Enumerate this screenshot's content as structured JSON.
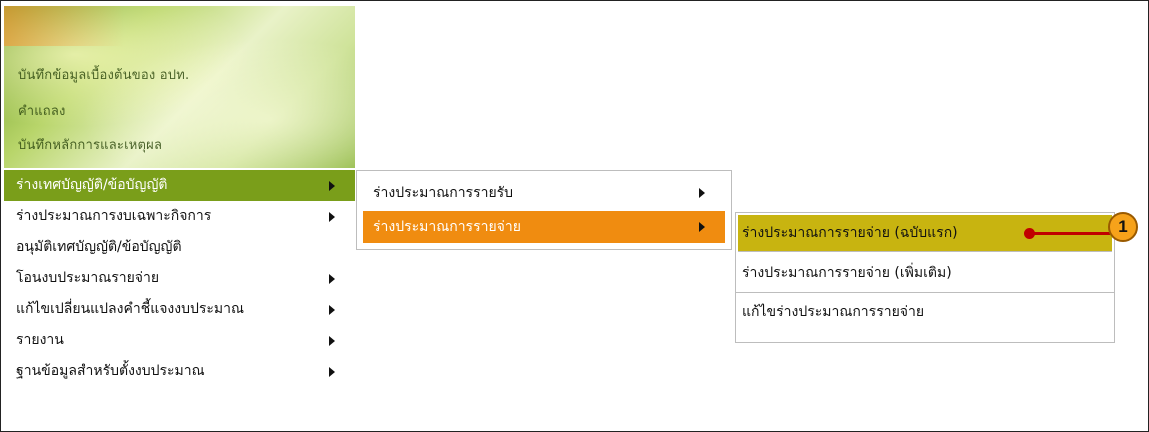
{
  "banner": {
    "items": [
      "บันทึกข้อมูลเบื้องต้นของ อปท.",
      "คำแถลง",
      "บันทึกหลักการและเหตุผล"
    ]
  },
  "menu_level1": {
    "items": [
      {
        "label": "ร่างเทศบัญญัติ/ข้อบัญญัติ",
        "has_submenu": true,
        "active": true
      },
      {
        "label": "ร่างประมาณการงบเฉพาะกิจการ",
        "has_submenu": true,
        "active": false
      },
      {
        "label": "อนุมัติเทศบัญญัติ/ข้อบัญญัติ",
        "has_submenu": false,
        "active": false
      },
      {
        "label": "โอนงบประมาณรายจ่าย",
        "has_submenu": true,
        "active": false
      },
      {
        "label": "แก้ไขเปลี่ยนแปลงคำชี้แจงงบประมาณ",
        "has_submenu": true,
        "active": false
      },
      {
        "label": "รายงาน",
        "has_submenu": true,
        "active": false
      },
      {
        "label": "ฐานข้อมูลสำหรับตั้งงบประมาณ",
        "has_submenu": true,
        "active": false
      }
    ]
  },
  "menu_level2": {
    "items": [
      {
        "label": "ร่างประมาณการรายรับ",
        "has_submenu": true,
        "active": false
      },
      {
        "label": "ร่างประมาณการรายจ่าย",
        "has_submenu": true,
        "active": true
      }
    ]
  },
  "menu_level3": {
    "items": [
      {
        "label": "ร่างประมาณการรายจ่าย (ฉบับแรก)",
        "active": true
      },
      {
        "label": "ร่างประมาณการรายจ่าย (เพิ่มเติม)",
        "active": false
      },
      {
        "label": "แก้ไขร่างประมาณการรายจ่าย",
        "active": false
      }
    ]
  },
  "callout": {
    "number": "1"
  },
  "colors": {
    "level1_active": "#7a9e1a",
    "level2_active": "#f08c10",
    "level3_active": "#c8b410",
    "callout_line": "#c00000",
    "callout_badge": "#f6a21a"
  }
}
